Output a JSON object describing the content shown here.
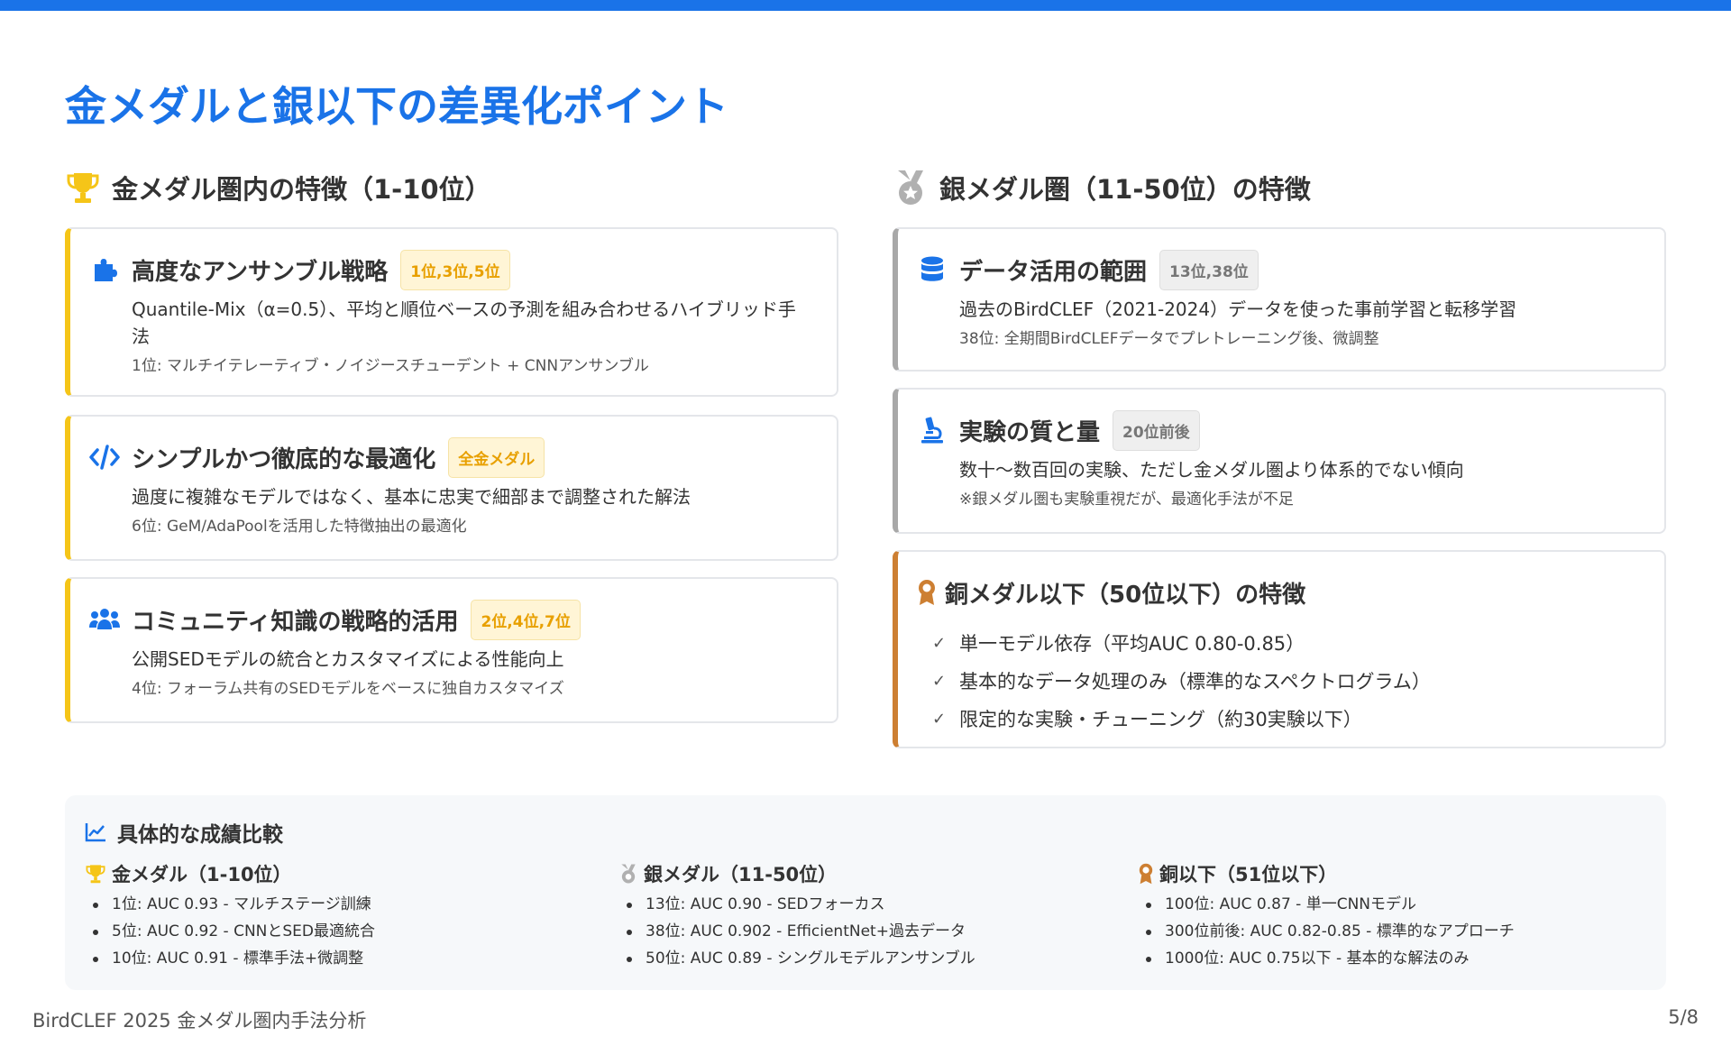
{
  "page": {
    "title": "金メダルと銀以下の差異化ポイント",
    "footer_left": "BirdCLEF 2025 金メダル圏内手法分析",
    "footer_right": "5/8"
  },
  "colors": {
    "accent": "#1a73e8",
    "gold": "#f5c518",
    "silver": "#a8a8a8",
    "bronze": "#cd7f32"
  },
  "gold_section": {
    "icon": "trophy-icon",
    "heading": "金メダル圏内の特徴（1-10位）",
    "cards": [
      {
        "icon": "puzzle-icon",
        "title": "高度なアンサンブル戦略",
        "badge": "1位,3位,5位",
        "description": "Quantile-Mix（α=0.5）、平均と順位ベースの予測を組み合わせるハイブリッド手法",
        "note": "1位: マルチイテレーティブ・ノイジースチューデント + CNNアンサンブル"
      },
      {
        "icon": "code-icon",
        "title": "シンプルかつ徹底的な最適化",
        "badge": "全金メダル",
        "description": "過度に複雑なモデルではなく、基本に忠実で細部まで調整された解法",
        "note": "6位: GeM/AdaPoolを活用した特徴抽出の最適化"
      },
      {
        "icon": "users-icon",
        "title": "コミュニティ知識の戦略的活用",
        "badge": "2位,4位,7位",
        "description": "公開SEDモデルの統合とカスタマイズによる性能向上",
        "note": "4位: フォーラム共有のSEDモデルをベースに独自カスタマイズ"
      }
    ]
  },
  "silver_section": {
    "icon": "silver-medal-icon",
    "heading": "銀メダル圏（11-50位）の特徴",
    "cards": [
      {
        "icon": "database-icon",
        "title": "データ活用の範囲",
        "badge": "13位,38位",
        "description": "過去のBirdCLEF（2021-2024）データを使った事前学習と転移学習",
        "note": "38位: 全期間BirdCLEFデータでプレトレーニング後、微調整"
      },
      {
        "icon": "microscope-icon",
        "title": "実験の質と量",
        "badge": "20位前後",
        "description": "数十〜数百回の実験、ただし金メダル圏より体系的でない傾向",
        "note": "※銀メダル圏も実験重視だが、最適化手法が不足"
      }
    ]
  },
  "bronze_section": {
    "icon": "bronze-award-icon",
    "heading": "銅メダル以下（50位以下）の特徴",
    "items": [
      "単一モデル依存（平均AUC 0.80-0.85）",
      "基本的なデータ処理のみ（標準的なスペクトログラム）",
      "限定的な実験・チューニング（約30実験以下）"
    ]
  },
  "comparison": {
    "icon": "line-chart-icon",
    "heading": "具体的な成績比較",
    "columns": [
      {
        "icon": "trophy-icon",
        "title": "金メダル（1-10位）",
        "items": [
          "1位: AUC 0.93 - マルチステージ訓練",
          "5位: AUC 0.92 - CNNとSED最適統合",
          "10位: AUC 0.91 - 標準手法+微調整"
        ]
      },
      {
        "icon": "silver-medal-icon",
        "title": "銀メダル（11-50位）",
        "items": [
          "13位: AUC 0.90 - SEDフォーカス",
          "38位: AUC 0.902 - EfficientNet+過去データ",
          "50位: AUC 0.89 - シングルモデルアンサンブル"
        ]
      },
      {
        "icon": "bronze-award-icon",
        "title": "銅以下（51位以下）",
        "items": [
          "100位: AUC 0.87 - 単一CNNモデル",
          "300位前後: AUC 0.82-0.85 - 標準的なアプローチ",
          "1000位: AUC 0.75以下 - 基本的な解法のみ"
        ]
      }
    ]
  }
}
